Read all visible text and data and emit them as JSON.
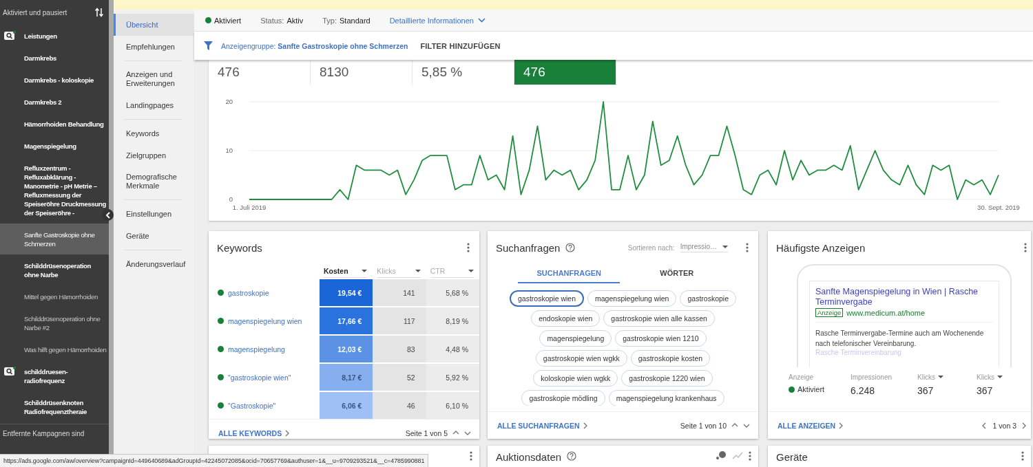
{
  "sidebar": {
    "header": "Aktiviert und pausiert",
    "items": [
      {
        "kind": "campaign",
        "label": "Leistungen",
        "paused": false,
        "selected": false
      },
      {
        "kind": "adgroup",
        "label": "Darmkrebs",
        "paused": false,
        "selected": false
      },
      {
        "kind": "adgroup",
        "label": "Darmkrebs - koloskopie",
        "paused": false,
        "selected": false
      },
      {
        "kind": "adgroup",
        "label": "Darmkrebs 2",
        "paused": false,
        "selected": false
      },
      {
        "kind": "adgroup",
        "label": "Hämorrhoiden Behandlung",
        "paused": false,
        "selected": false
      },
      {
        "kind": "adgroup",
        "label": "Magenspiegelung",
        "paused": false,
        "selected": false
      },
      {
        "kind": "adgroup",
        "label": "Refluxzentrum - Refluxabklärung - Manometrie - pH Metrie – Refluxmessung der Speiseröhre Druckmessung der Speiseröhre -",
        "paused": false,
        "selected": false
      },
      {
        "kind": "adgroup",
        "label": "Sanfte Gastroskopie ohne Schmerzen",
        "paused": false,
        "selected": true
      },
      {
        "kind": "adgroup",
        "label": "Schilddrüsenoperation ohne Narbe",
        "paused": false,
        "selected": false
      },
      {
        "kind": "adgroup",
        "label": "Mittel gegen Hämorrhoiden",
        "paused": true,
        "selected": false
      },
      {
        "kind": "adgroup",
        "label": "Schilddrüsenoperation ohne Narbe #2",
        "paused": true,
        "selected": false
      },
      {
        "kind": "adgroup",
        "label": "Was hilft gegen Hämorrhoiden",
        "paused": true,
        "selected": false
      },
      {
        "kind": "campaign",
        "label": "schilddruesen-radiofrequenz",
        "paused": false,
        "selected": false
      },
      {
        "kind": "adgroup",
        "label": "Schilddrüsenknoten Radiofrequenztheraie",
        "paused": false,
        "selected": false
      }
    ],
    "footer": "Entfernte Kampagnen sind"
  },
  "nav": {
    "groups": [
      {
        "items": [
          {
            "label": "Übersicht",
            "selected": true
          },
          {
            "label": "Empfehlungen",
            "selected": false
          }
        ]
      },
      {
        "items": [
          {
            "label": "Anzeigen und Erweiterungen",
            "selected": false
          },
          {
            "label": "Landingpages",
            "selected": false
          }
        ]
      },
      {
        "items": [
          {
            "label": "Keywords",
            "selected": false
          },
          {
            "label": "Zielgruppen",
            "selected": false
          },
          {
            "label": "Demografische Merkmale",
            "selected": false
          }
        ]
      },
      {
        "items": [
          {
            "label": "Einstellungen",
            "selected": false
          },
          {
            "label": "Geräte",
            "selected": false
          }
        ]
      },
      {
        "items": [
          {
            "label": "Änderungsverlauf",
            "selected": false
          }
        ]
      }
    ]
  },
  "header": {
    "status": {
      "label": "Aktiviert",
      "enabled": true
    },
    "fields": [
      {
        "label": "Status:",
        "value": "Aktiv"
      },
      {
        "label": "Typ:",
        "value": "Standard"
      }
    ],
    "details_link": "Detaillierte Informationen"
  },
  "filter_bar": {
    "filter": "Anzeigengruppe: **Sanfte Gastroskopie ohne Schmerzen**",
    "add_filter": "FILTER HINZUFÜGEN"
  },
  "overview": {
    "metrics": [
      {
        "value": "476",
        "selected": false
      },
      {
        "value": "8130",
        "selected": false
      },
      {
        "value": "5,85 %",
        "selected": false
      },
      {
        "value": "476",
        "selected": true
      }
    ],
    "chart_data": {
      "type": "line",
      "categories": [
        "1. Juli 2019",
        null,
        null,
        null,
        null,
        null,
        null,
        null,
        null,
        null,
        null,
        null,
        null,
        null,
        null,
        null,
        null,
        null,
        null,
        null,
        null,
        null,
        null,
        null,
        null,
        null,
        null,
        null,
        null,
        null,
        null,
        null,
        null,
        null,
        null,
        null,
        null,
        null,
        null,
        null,
        null,
        null,
        null,
        null,
        null,
        null,
        null,
        null,
        null,
        null,
        null,
        null,
        null,
        null,
        null,
        null,
        null,
        null,
        null,
        null,
        null,
        null,
        null,
        null,
        null,
        null,
        null,
        null,
        null,
        null,
        null,
        null,
        null,
        null,
        null,
        null,
        null,
        null,
        null,
        null,
        null,
        null,
        null,
        null,
        null,
        null,
        null,
        null,
        null,
        null,
        null,
        "30. Sept. 2019"
      ],
      "ylim": [
        0,
        20
      ],
      "yticks": [
        0,
        10,
        20
      ],
      "series": [
        {
          "color": "#1e8e3e",
          "values": [
            0,
            0,
            0,
            0,
            0,
            0,
            0,
            0,
            0,
            0,
            0,
            2,
            0,
            7,
            6,
            6,
            6,
            5,
            6,
            1,
            4,
            8,
            9,
            9,
            9,
            2,
            3,
            3,
            9,
            4,
            5,
            2,
            13,
            1,
            6,
            15,
            4,
            6,
            5,
            6,
            2,
            4,
            8,
            20,
            2,
            2,
            9,
            2,
            5,
            16,
            7,
            8,
            13,
            7,
            3,
            5,
            9,
            9,
            15,
            9,
            2,
            1,
            5,
            6,
            3,
            10,
            4,
            8,
            5,
            6,
            6,
            7,
            6,
            11,
            2,
            6,
            10,
            6,
            4,
            3,
            7,
            3,
            1,
            7,
            6,
            7,
            0,
            4,
            3,
            4,
            1,
            5
          ]
        }
      ]
    }
  },
  "keywords": {
    "title": "Keywords",
    "columns": [
      {
        "label": "Kosten",
        "sorted": true
      },
      {
        "label": "Klicks",
        "sorted": false
      },
      {
        "label": "CTR",
        "sorted": false
      }
    ],
    "rows": [
      {
        "keyword": "gastroskopie",
        "enabled": true,
        "cost": "19,54 €",
        "color": "#1b66d6",
        "clicks": "141",
        "ctr": "5,68 %"
      },
      {
        "keyword": "magenspiegelung wien",
        "enabled": true,
        "cost": "17,66 €",
        "color": "#2a72de",
        "clicks": "117",
        "ctr": "8,19 %"
      },
      {
        "keyword": "magenspiegelung",
        "enabled": true,
        "cost": "12,03 €",
        "color": "#5b92e6",
        "clicks": "83",
        "ctr": "4,48 %"
      },
      {
        "keyword": "\"gastroskopie wien\"",
        "enabled": true,
        "cost": "8,17 €",
        "color": "#86aff0",
        "clicks": "52",
        "ctr": "5,92 %"
      },
      {
        "keyword": "\"Gastroskopie\"",
        "enabled": true,
        "cost": "6,06 €",
        "color": "#9fc0f4",
        "clicks": "46",
        "ctr": "6,10 %"
      }
    ],
    "link": "ALLE KEYWORDS",
    "pager": "Seite 1 von 5"
  },
  "search_terms": {
    "title": "Suchanfragen",
    "sort_label": "Sortieren nach:",
    "sort_value": "Impressio…",
    "tabs": [
      {
        "label": "SUCHANFRAGEN",
        "selected": true
      },
      {
        "label": "WÖRTER",
        "selected": false
      }
    ],
    "chips": [
      {
        "label": "gastroskopie wien",
        "selected": true
      },
      {
        "label": "magenspiegelung wien",
        "selected": false
      },
      {
        "label": "gastroskopie",
        "selected": false
      },
      {
        "label": "endoskopie wien",
        "selected": false
      },
      {
        "label": "gastroskopie wien alle kassen",
        "selected": false
      },
      {
        "label": "magenspiegelung",
        "selected": false
      },
      {
        "label": "gastroskopie wien 1210",
        "selected": false
      },
      {
        "label": "gastroskopie wien wgkk",
        "selected": false
      },
      {
        "label": "gastroskopie kosten",
        "selected": false
      },
      {
        "label": "koloskopie wien wgkk",
        "selected": false
      },
      {
        "label": "gastroskopie 1220 wien",
        "selected": false
      },
      {
        "label": "gastroskopie mödling",
        "selected": false
      },
      {
        "label": "magenspiegelung krankenhaus",
        "selected": false
      }
    ],
    "link": "ALLE SUCHANFRAGEN",
    "pager": "Seite 1 von 10"
  },
  "top_ads": {
    "title": "Häufigste Anzeigen",
    "ad": {
      "headline": "Sanfte Magenspiegelung in Wien | Rasche Terminvergabe",
      "badge": "Anzeige",
      "url": "www.medicum.at/home",
      "description": "Rasche Terminvergabe-Termine auch am Wochenende nach telefonischer Vereinbarung.",
      "extension": "Rasche Terminvereinbarung"
    },
    "stats": [
      {
        "kind": "status",
        "label": "Anzeige",
        "value": "Aktiviert",
        "enabled": true
      },
      {
        "kind": "number",
        "label": "Impressionen",
        "value": "6.248"
      },
      {
        "kind": "sortable",
        "label": "Klicks",
        "value": "367"
      },
      {
        "kind": "sortable",
        "label": "Klicks",
        "value": "367"
      }
    ],
    "link": "ALLE ANZEIGEN",
    "pager": "1 von 3"
  },
  "lower_cards": [
    {
      "kind": "untitled"
    },
    {
      "kind": "auction",
      "title": "Auktionsdaten"
    },
    {
      "kind": "plain",
      "title": "Geräte"
    }
  ],
  "status_bar": "https://ads.google.com/aw/overview?campaignId=449640689&adGroupId=42245072085&ocid=70657769&authuser=1&__u=9709293521&__c=4785990881"
}
